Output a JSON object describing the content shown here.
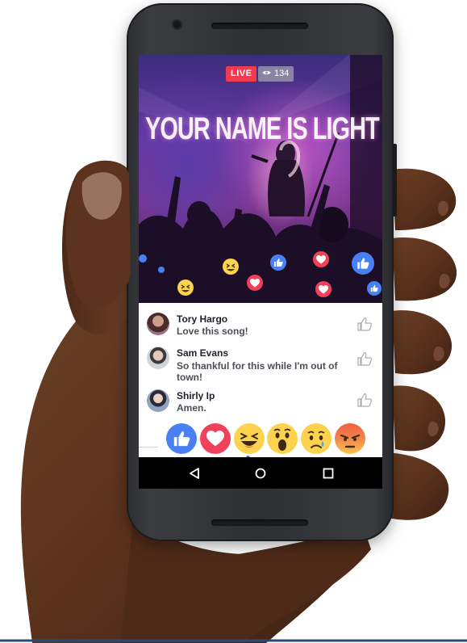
{
  "video": {
    "live_label": "LIVE",
    "viewer_count": "134",
    "title": "YOUR NAME IS LIGHT"
  },
  "comments": [
    {
      "name": "Tory Hargo",
      "text": "Love this song!"
    },
    {
      "name": "Sam Evans",
      "text": "So thankful for this while I'm out of town!"
    },
    {
      "name": "Shirly Ip",
      "text": "Amen."
    }
  ],
  "reactions": [
    "like",
    "love",
    "haha",
    "wow",
    "sad",
    "angry"
  ],
  "navigation": [
    "back",
    "home",
    "recents"
  ],
  "colors": {
    "live_badge": "#f33b4f",
    "like_blue": "#4a80f5",
    "love_red": "#f0405a",
    "haha_yellow": "#fcd24e",
    "angry_red": "#f2603e"
  }
}
